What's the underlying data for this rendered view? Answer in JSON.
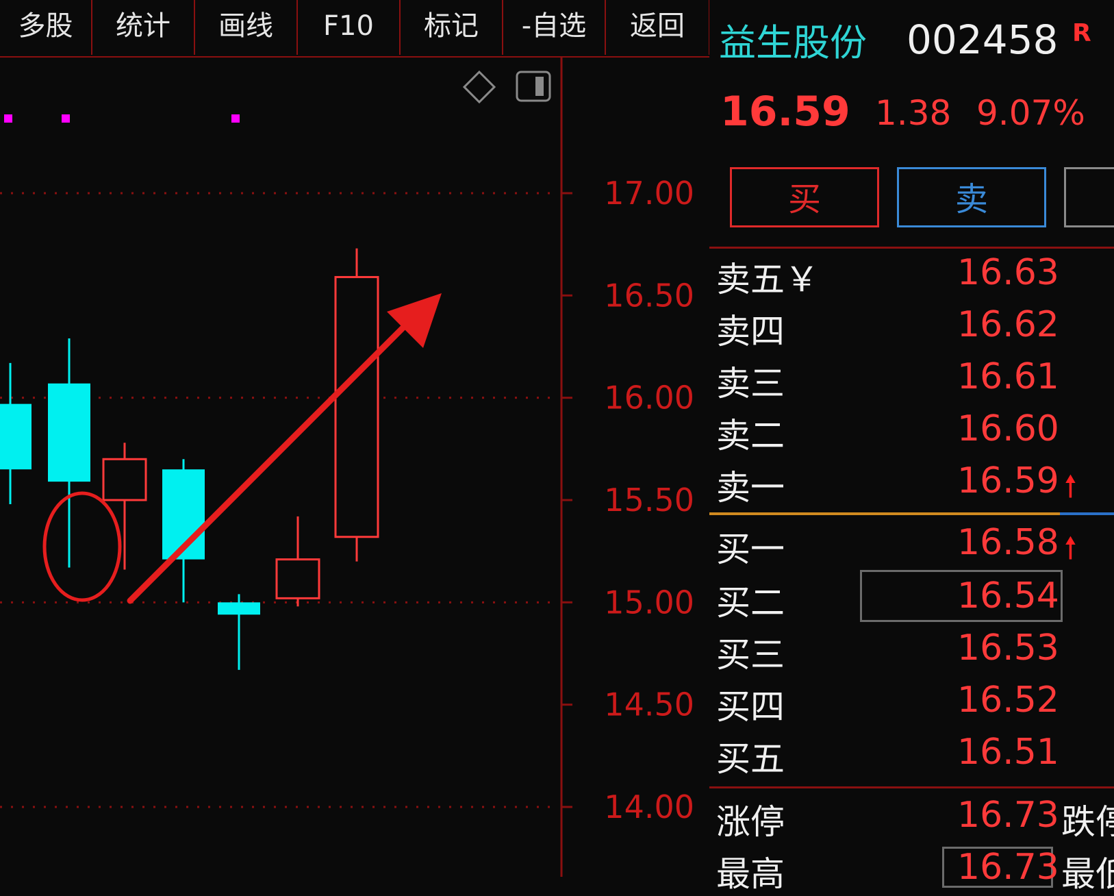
{
  "toolbar": {
    "items": [
      "多股",
      "统计",
      "画线",
      "F10",
      "标记",
      "-自选",
      "返回"
    ]
  },
  "chart_data": {
    "type": "candlestick",
    "y_ticks": [
      "17.00",
      "16.50",
      "16.00",
      "15.50",
      "15.00",
      "14.50",
      "14.00"
    ],
    "candles": [
      {
        "open": 15.97,
        "close": 15.65,
        "high": 16.17,
        "low": 15.48,
        "color": "cyan"
      },
      {
        "open": 16.07,
        "close": 15.59,
        "high": 16.29,
        "low": 15.17,
        "color": "cyan"
      },
      {
        "open": 15.5,
        "close": 15.7,
        "high": 15.78,
        "low": 15.16,
        "color": "red"
      },
      {
        "open": 15.65,
        "close": 15.21,
        "high": 15.7,
        "low": 15.0,
        "color": "cyan"
      },
      {
        "open": 15.0,
        "close": 14.94,
        "high": 15.04,
        "low": 14.67,
        "color": "cyan"
      },
      {
        "open": 15.02,
        "close": 15.21,
        "high": 15.42,
        "low": 14.98,
        "color": "red"
      },
      {
        "open": 15.32,
        "close": 16.59,
        "high": 16.73,
        "low": 15.2,
        "color": "red"
      }
    ],
    "colors": {
      "up": "#ff3a3a",
      "down": "#00f0f0",
      "grid": "#8a1010",
      "axis_text": "#cc1a1a",
      "marker": "#ff00ff",
      "annotation": "#e61e1e"
    }
  },
  "quote": {
    "name": "益生股份",
    "code": "002458",
    "flag": "R",
    "price": "16.59",
    "change": "1.38",
    "change_pct": "9.07%",
    "buy_label": "买",
    "sell_label": "卖"
  },
  "orderbook": {
    "asks": [
      {
        "label": "卖五￥",
        "price": "16.63"
      },
      {
        "label": "卖四",
        "price": "16.62"
      },
      {
        "label": "卖三",
        "price": "16.61"
      },
      {
        "label": "卖二",
        "price": "16.60"
      },
      {
        "label": "卖一",
        "price": "16.59",
        "arrow": "🠕"
      }
    ],
    "bids": [
      {
        "label": "买一",
        "price": "16.58",
        "arrow": "🠕"
      },
      {
        "label": "买二",
        "price": "16.54"
      },
      {
        "label": "买三",
        "price": "16.53"
      },
      {
        "label": "买四",
        "price": "16.52"
      },
      {
        "label": "买五",
        "price": "16.51"
      }
    ]
  },
  "limits": {
    "limit_up_label": "涨停",
    "limit_up_price": "16.73",
    "limit_down_label": "跌停",
    "high_label": "最高",
    "high_price": "16.73",
    "low_label": "最低"
  }
}
